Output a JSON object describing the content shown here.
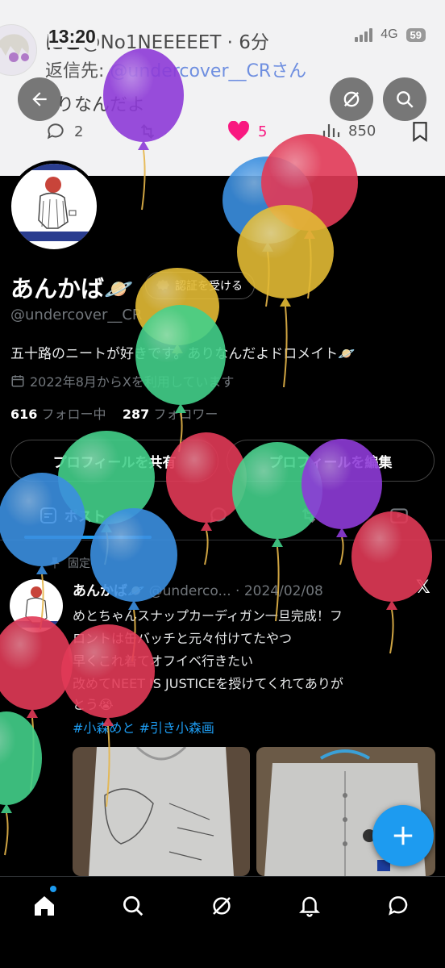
{
  "status_bar": {
    "time": "13:20",
    "network": "4G",
    "battery": "59"
  },
  "reply_header": {
    "name": "にこ",
    "handle_time": "@No1NEEEEET · 6分",
    "reply_to_prefix": "返信先: ",
    "reply_to_handle": "@undercover__CR",
    "reply_to_suffix": "さん",
    "text": "りなんだよ",
    "replies": "2",
    "likes": "5",
    "views": "850"
  },
  "profile": {
    "display_name": "あんかば",
    "verify_label": "認証を受ける",
    "handle": "@undercover__CR",
    "bio": "五十路のニートが好きです。ありなんだよドロメイト",
    "joined": "2022年8月からXを利用しています",
    "following_count": "616",
    "following_label": "フォロー中",
    "followers_count": "287",
    "followers_label": "フォロワー",
    "share_button": "プロフィールを共有",
    "edit_button": "プロフィールを編集"
  },
  "tabs": {
    "posts": "ポスト"
  },
  "post": {
    "pinned_label": "固定",
    "author": "あんかば",
    "meta": "@underco... · 2024/02/08",
    "lines": [
      "めとちゃんスナップカーディガン一旦完成！フ",
      "ロントは缶バッチと元々付けてたやつ",
      "早くこれ着てオフイベ行きたい",
      "改めてNEET IS JUSTICEを授けてくれてありが",
      "とう😭"
    ],
    "hashtags": "#小森めと #引き小森画"
  },
  "colors": {
    "accent": "#1d9bf0",
    "like": "#f91880",
    "background": "#000000"
  },
  "icons": [
    "back-arrow-icon",
    "grok-icon",
    "search-icon",
    "reply-icon",
    "retweet-icon",
    "heart-icon",
    "views-icon",
    "bookmark-icon",
    "calendar-icon",
    "pin-icon",
    "x-logo-icon",
    "home-icon",
    "bell-icon",
    "messages-icon",
    "compose-icon"
  ]
}
